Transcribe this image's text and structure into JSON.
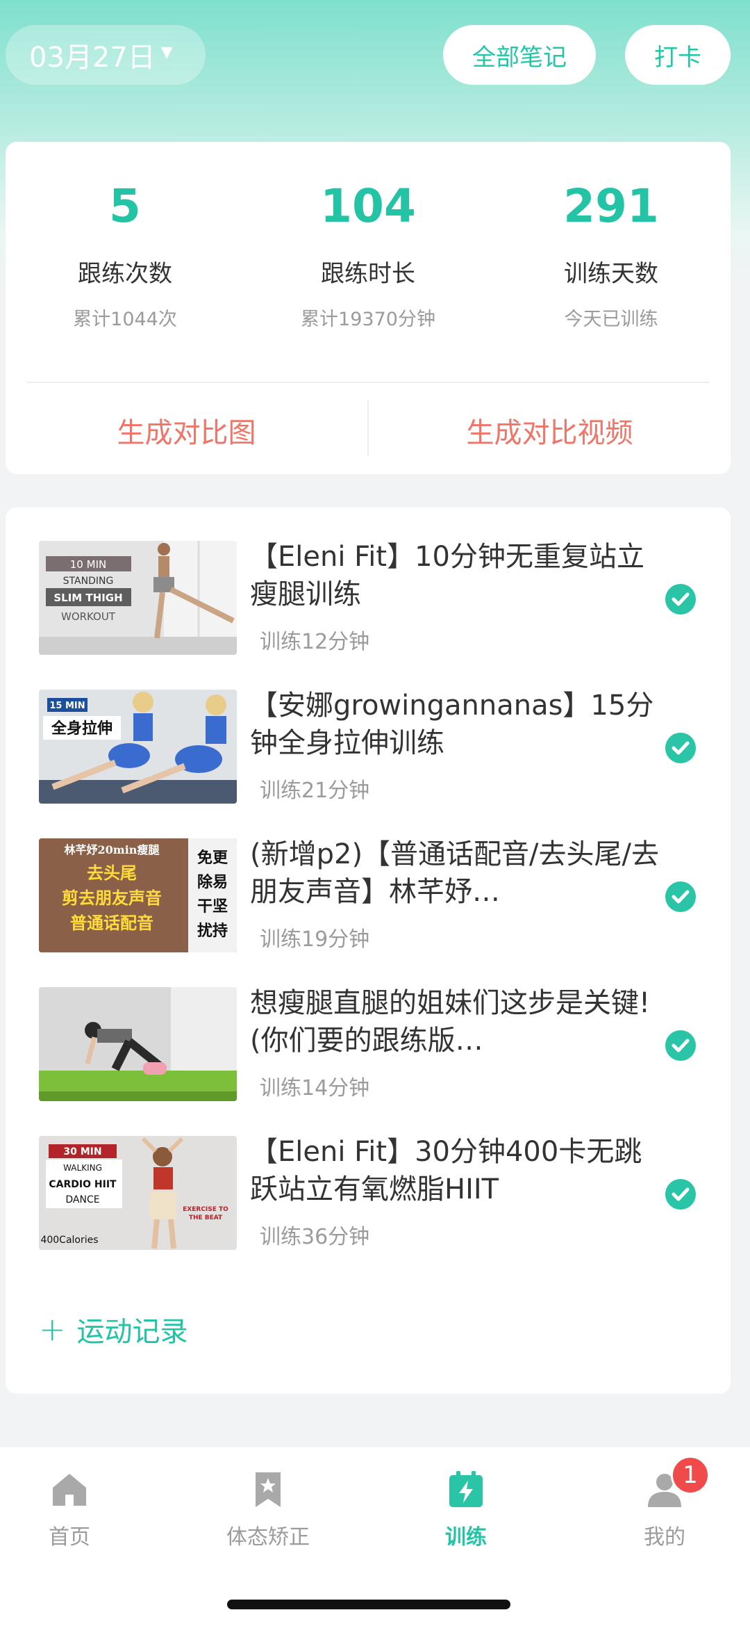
{
  "header": {
    "date": "03月27日",
    "all_notes": "全部笔记",
    "check_in": "打卡"
  },
  "stats": [
    {
      "value": "5",
      "label": "跟练次数",
      "sub": "累计1044次"
    },
    {
      "value": "104",
      "label": "跟练时长",
      "sub": "累计19370分钟"
    },
    {
      "value": "291",
      "label": "训练天数",
      "sub": "今天已训练"
    }
  ],
  "actions": {
    "compare_image": "生成对比图",
    "compare_video": "生成对比视频"
  },
  "workouts": [
    {
      "title": "【Eleni Fit】10分钟无重复站立瘦腿训练",
      "duration": "训练12分钟",
      "thumb_lines": [
        "10 MIN",
        "STANDING",
        "SLIM THIGH",
        "WORKOUT"
      ]
    },
    {
      "title": "【安娜growingannanas】15分钟全身拉伸训练",
      "duration": "训练21分钟",
      "thumb_lines": [
        "15 MIN",
        "全身拉伸"
      ]
    },
    {
      "title": "(新增p2)【普通话配音/去头尾/去朋友声音】林芊妤…",
      "duration": "训练19分钟",
      "thumb_lines": [
        "林芊妤20min瘦腿",
        "去头尾",
        "剪去朋友声音",
        "普通话配音",
        "免更",
        "除易",
        "干坚",
        "扰持"
      ]
    },
    {
      "title": "想瘦腿直腿的姐妹们这步是关键!(你们要的跟练版…",
      "duration": "训练14分钟",
      "thumb_lines": []
    },
    {
      "title": "【Eleni Fit】30分钟400卡无跳跃站立有氧燃脂HIIT",
      "duration": "训练36分钟",
      "thumb_lines": [
        "30 MIN",
        "WALKING",
        "CARDIO HIIT",
        "DANCE",
        "EXERCISE TO",
        "THE BEAT",
        "400Calories"
      ]
    }
  ],
  "add_record": "运动记录",
  "tabs": [
    {
      "label": "首页",
      "icon": "home-icon"
    },
    {
      "label": "体态矫正",
      "icon": "bookmark-star-icon"
    },
    {
      "label": "训练",
      "icon": "training-calendar-icon"
    },
    {
      "label": "我的",
      "icon": "person-icon"
    }
  ],
  "badge_count": "1",
  "colors": {
    "accent": "#23c4a6",
    "action": "#f07568",
    "badge": "#f04a4a"
  }
}
